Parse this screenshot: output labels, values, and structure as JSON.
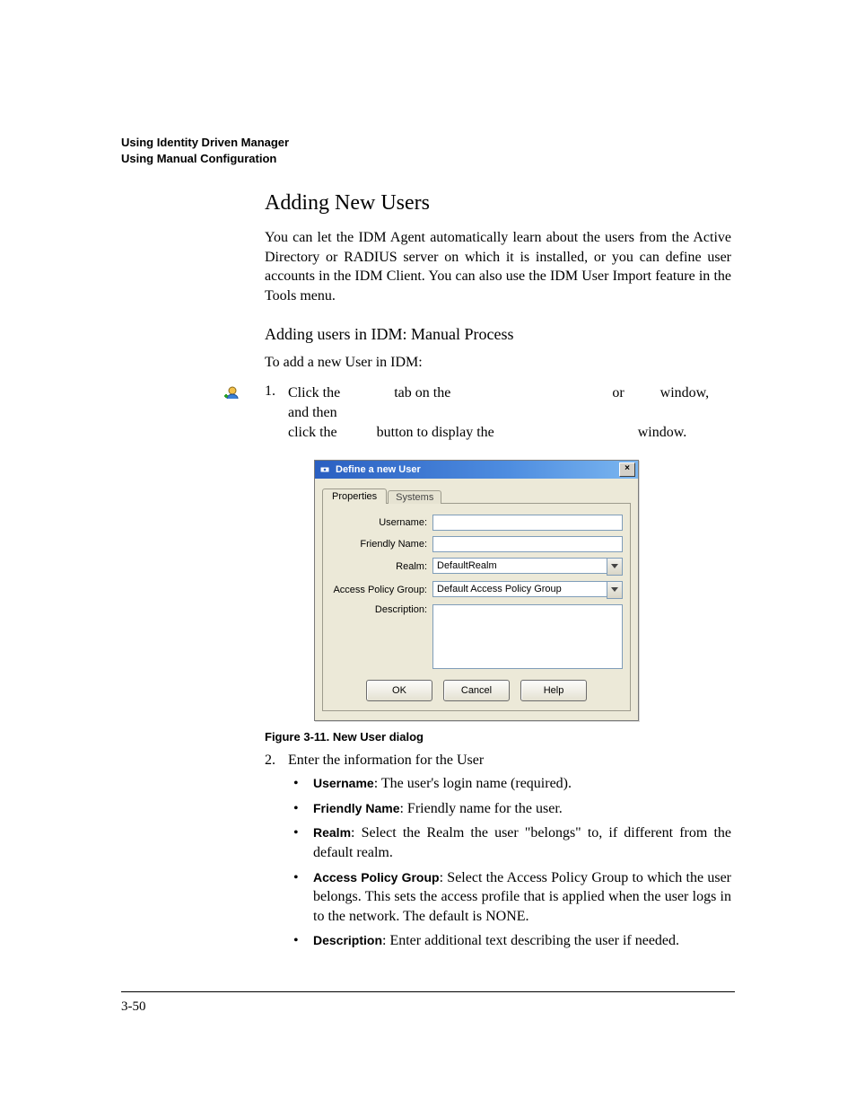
{
  "header": {
    "line1": "Using Identity Driven Manager",
    "line2": "Using Manual Configuration"
  },
  "section": {
    "title": "Adding New Users",
    "intro": "You can let the IDM Agent automatically learn about the users from the Active Directory or RADIUS server on which it is installed, or you can define user accounts in the IDM Client. You can also use the IDM User Import feature in the Tools menu.",
    "sub": "Adding users in IDM: Manual Process",
    "lead": "To add a new User in IDM:"
  },
  "step1": {
    "num": "1.",
    "a": "Click the",
    "b": "tab on the",
    "c": "or",
    "d": "window, and then",
    "e": "click the",
    "f": "button to display the",
    "g": "window."
  },
  "dialog": {
    "title": "Define a new User",
    "tabs": {
      "properties": "Properties",
      "systems": "Systems"
    },
    "labels": {
      "username": "Username:",
      "friendly": "Friendly Name:",
      "realm": "Realm:",
      "apg": "Access Policy Group:",
      "desc": "Description:"
    },
    "values": {
      "username": "",
      "friendly": "",
      "realm": "DefaultRealm",
      "apg": "Default Access Policy Group",
      "desc": ""
    },
    "buttons": {
      "ok": "OK",
      "cancel": "Cancel",
      "help": "Help"
    },
    "close": "×"
  },
  "fig_caption": "Figure 3-11. New User dialog",
  "step2": {
    "num": "2.",
    "text": "Enter the information for the User"
  },
  "bullets": {
    "username_b": "Username",
    "username_t": ": The user's login name (required).",
    "friendly_b": "Friendly Name",
    "friendly_t": ": Friendly name for the user.",
    "realm_b": "Realm",
    "realm_t": ": Select the Realm the user \"belongs\" to, if different from the default realm.",
    "apg_b": "Access Policy Group",
    "apg_t": ": Select the Access Policy Group to which the user belongs. This sets the access profile that is applied when the user logs in to the network. The default is NONE.",
    "desc_b": "Description",
    "desc_t": ": Enter additional text describing the user if needed."
  },
  "page_number": "3-50"
}
